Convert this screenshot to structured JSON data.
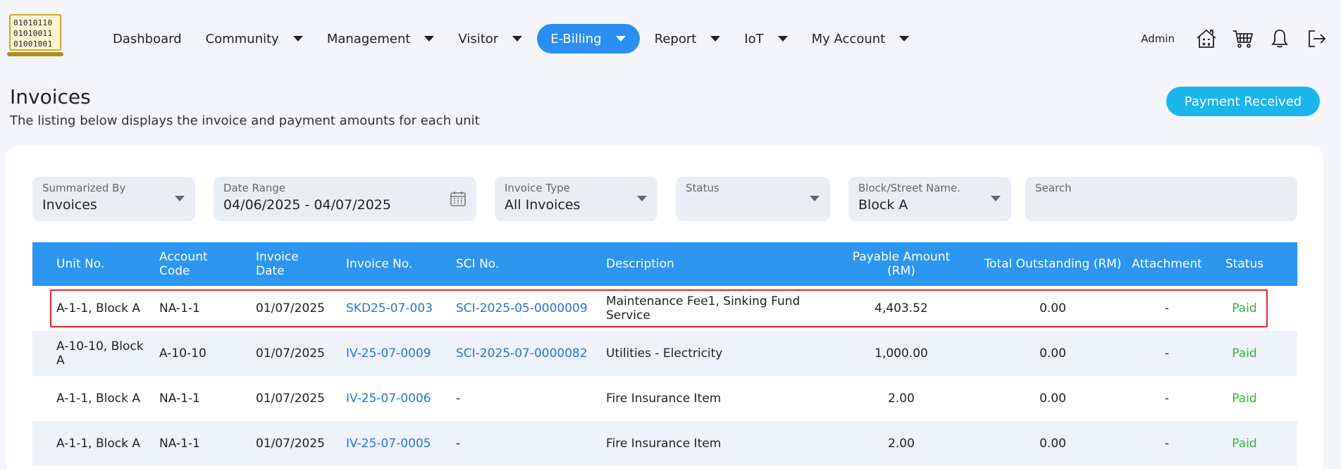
{
  "logo": {
    "lines": [
      "01010110",
      "01010011",
      "01001001"
    ]
  },
  "nav": {
    "items": [
      {
        "label": "Dashboard",
        "caret": false,
        "active": false
      },
      {
        "label": "Community",
        "caret": true,
        "active": false
      },
      {
        "label": "Management",
        "caret": true,
        "active": false
      },
      {
        "label": "Visitor",
        "caret": true,
        "active": false
      },
      {
        "label": "E-Billing",
        "caret": true,
        "active": true
      },
      {
        "label": "Report",
        "caret": true,
        "active": false
      },
      {
        "label": "IoT",
        "caret": true,
        "active": false
      },
      {
        "label": "My Account",
        "caret": true,
        "active": false
      }
    ]
  },
  "user": {
    "label": "Admin",
    "icons": [
      "property-calculator-icon",
      "cart-icon",
      "bell-icon",
      "logout-icon"
    ]
  },
  "page": {
    "title": "Invoices",
    "subtitle": "The listing below displays the invoice and payment amounts for each unit",
    "payment_button": "Payment Received"
  },
  "filters": {
    "summarized_by": {
      "label": "Summarized By",
      "value": "Invoices"
    },
    "date_range": {
      "label": "Date Range",
      "value": "04/06/2025 - 04/07/2025"
    },
    "invoice_type": {
      "label": "Invoice Type",
      "value": "All Invoices"
    },
    "status": {
      "label": "Status",
      "value": ""
    },
    "block": {
      "label": "Block/Street Name.",
      "value": "Block A"
    },
    "search": {
      "label": "Search",
      "value": ""
    }
  },
  "table": {
    "headers": {
      "unit_no": "Unit No.",
      "account_code": "Account Code",
      "invoice_date": "Invoice Date",
      "invoice_no": "Invoice No.",
      "sci_no": "SCI No.",
      "description": "Description",
      "payable_amount": "Payable Amount (RM)",
      "total_outstanding": "Total Outstanding (RM)",
      "attachment": "Attachment",
      "status": "Status"
    },
    "rows": [
      {
        "unit_no": "A-1-1, Block A",
        "account_code": "NA-1-1",
        "invoice_date": "01/07/2025",
        "invoice_no": "SKD25-07-003",
        "sci_no": "SCI-2025-05-0000009",
        "description": "Maintenance Fee1, Sinking Fund Service",
        "payable_amount": "4,403.52",
        "total_outstanding": "0.00",
        "attachment": "-",
        "status": "Paid"
      },
      {
        "unit_no": "A-10-10, Block A",
        "account_code": "A-10-10",
        "invoice_date": "01/07/2025",
        "invoice_no": "IV-25-07-0009",
        "sci_no": "SCI-2025-07-0000082",
        "description": "Utilities - Electricity",
        "payable_amount": "1,000.00",
        "total_outstanding": "0.00",
        "attachment": "-",
        "status": "Paid"
      },
      {
        "unit_no": "A-1-1, Block A",
        "account_code": "NA-1-1",
        "invoice_date": "01/07/2025",
        "invoice_no": "IV-25-07-0006",
        "sci_no": "-",
        "description": "Fire Insurance Item",
        "payable_amount": "2.00",
        "total_outstanding": "0.00",
        "attachment": "-",
        "status": "Paid"
      },
      {
        "unit_no": "A-1-1, Block A",
        "account_code": "NA-1-1",
        "invoice_date": "01/07/2025",
        "invoice_no": "IV-25-07-0005",
        "sci_no": "-",
        "description": "Fire Insurance Item",
        "payable_amount": "2.00",
        "total_outstanding": "0.00",
        "attachment": "-",
        "status": "Paid"
      }
    ]
  },
  "colors": {
    "accent": "#2b8ef2",
    "header_bg": "#2b95ef",
    "paid": "#36b83a",
    "link": "#2a76d2",
    "highlight": "#e5222a",
    "payment_button": "#1bb5ec"
  }
}
